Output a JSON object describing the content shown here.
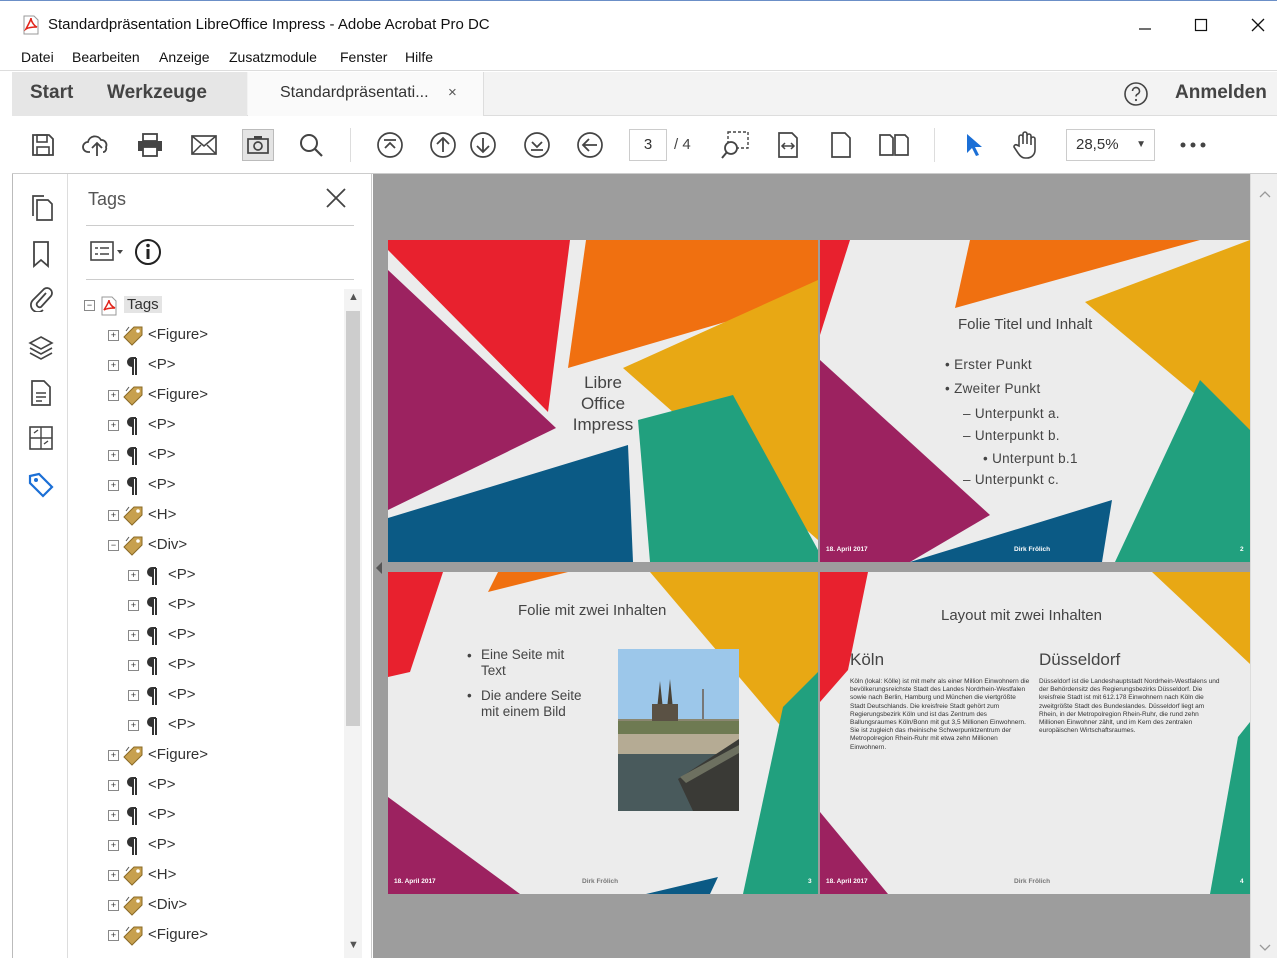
{
  "window": {
    "title": "Standardpräsentation LibreOffice Impress - Adobe Acrobat Pro DC"
  },
  "menu": [
    "Datei",
    "Bearbeiten",
    "Anzeige",
    "Zusatzmodule",
    "Fenster",
    "Hilfe"
  ],
  "tabs": {
    "start": "Start",
    "tools": "Werkzeuge",
    "document": "Standardpräsentati...",
    "close_glyph": "×",
    "signin": "Anmelden"
  },
  "toolbar": {
    "page_current": "3",
    "page_total": "/ 4",
    "zoom": "28,5%"
  },
  "panel": {
    "title": "Tags",
    "tree": [
      {
        "label": "Tags",
        "icon": "pdf-icon",
        "level": 0,
        "expanded": true
      },
      {
        "label": "<Figure>",
        "icon": "tag-icon",
        "level": 1
      },
      {
        "label": "<P>",
        "icon": "paragraph-icon",
        "level": 1
      },
      {
        "label": "<Figure>",
        "icon": "tag-icon",
        "level": 1
      },
      {
        "label": "<P>",
        "icon": "paragraph-icon",
        "level": 1
      },
      {
        "label": "<P>",
        "icon": "paragraph-icon",
        "level": 1
      },
      {
        "label": "<P>",
        "icon": "paragraph-icon",
        "level": 1
      },
      {
        "label": "<H>",
        "icon": "tag-icon",
        "level": 1
      },
      {
        "label": "<Div>",
        "icon": "tag-icon",
        "level": 1,
        "expanded": true
      },
      {
        "label": "<P>",
        "icon": "paragraph-icon",
        "level": 2
      },
      {
        "label": "<P>",
        "icon": "paragraph-icon",
        "level": 2
      },
      {
        "label": "<P>",
        "icon": "paragraph-icon",
        "level": 2
      },
      {
        "label": "<P>",
        "icon": "paragraph-icon",
        "level": 2
      },
      {
        "label": "<P>",
        "icon": "paragraph-icon",
        "level": 2
      },
      {
        "label": "<P>",
        "icon": "paragraph-icon",
        "level": 2
      },
      {
        "label": "<Figure>",
        "icon": "tag-icon",
        "level": 1
      },
      {
        "label": "<P>",
        "icon": "paragraph-icon",
        "level": 1
      },
      {
        "label": "<P>",
        "icon": "paragraph-icon",
        "level": 1
      },
      {
        "label": "<P>",
        "icon": "paragraph-icon",
        "level": 1
      },
      {
        "label": "<H>",
        "icon": "tag-icon",
        "level": 1
      },
      {
        "label": "<Div>",
        "icon": "tag-icon",
        "level": 1
      },
      {
        "label": "<Figure>",
        "icon": "tag-icon",
        "level": 1
      }
    ]
  },
  "slides": {
    "s1": {
      "title": "Libre\nOffice\nImpress"
    },
    "s2": {
      "title": "Folie Titel und Inhalt",
      "bullets": [
        "• Erster Punkt",
        "• Zweiter Punkt",
        "– Unterpunkt a.",
        "– Unterpunkt b.",
        "• Unterpunt b.1",
        "– Unterpunkt c."
      ],
      "date": "18. April 2017",
      "author": "Dirk Frölich",
      "num": "2"
    },
    "s3": {
      "title": "Folie mit zwei Inhalten",
      "b1": "Eine Seite mit\nText",
      "b2": "Die andere Seite\nmit einem Bild",
      "date": "18. April 2017",
      "author": "Dirk Frölich",
      "num": "3"
    },
    "s4": {
      "title": "Layout mit zwei Inhalten",
      "col1_title": "Köln",
      "col1_text": "Köln (lokal: Kölle) ist mit mehr als einer Million Einwohnern die bevölkerungsreichste Stadt des Landes Nordrhein-Westfalen sowie nach Berlin, Hamburg und München die viertgrößte Stadt Deutschlands. Die kreisfreie Stadt gehört zum Regierungsbezirk Köln und ist das Zentrum des Ballungsraumes Köln/Bonn mit gut 3,5 Millionen Einwohnern. Sie ist zugleich das rheinische Schwerpunktzentrum der Metropolregion Rhein-Ruhr mit etwa zehn Millionen Einwohnern.",
      "col2_title": "Düsseldorf",
      "col2_text": "Düsseldorf ist die Landeshauptstadt Nordrhein-Westfalens und der Behördensitz des Regierungsbezirks Düsseldorf. Die kreisfreie Stadt ist mit 612.178 Einwohnern nach Köln die zweitgrößte Stadt des Bundeslandes. Düsseldorf liegt am Rhein, in der Metropolregion Rhein-Ruhr, die rund zehn Millionen Einwohner zählt, und im Kern des zentralen europäischen Wirtschaftsraumes.",
      "date": "18. April 2017",
      "author": "Dirk Frölich",
      "num": "4"
    }
  },
  "colors": {
    "red": "#e8212e",
    "orange": "#f07010",
    "yellow": "#e8a814",
    "magenta": "#9c2260",
    "teal": "#21a07e",
    "blue": "#0b5a85",
    "accent_blue": "#1b6fd6"
  }
}
